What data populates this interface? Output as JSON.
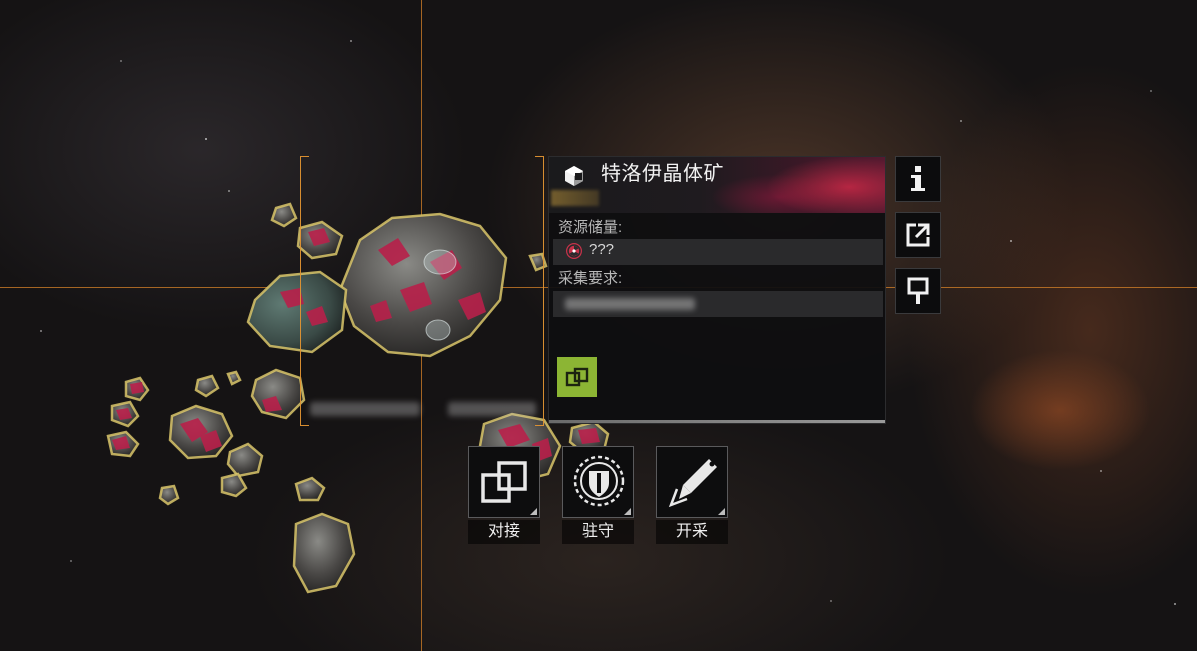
{
  "target": {
    "name": "特洛伊晶体矿",
    "reserves_label": "资源储量:",
    "reserves_value": "???",
    "requirements_label": "采集要求:"
  },
  "side_buttons": [
    {
      "icon": "info-icon"
    },
    {
      "icon": "external-link-icon"
    },
    {
      "icon": "pin-icon"
    }
  ],
  "actions": [
    {
      "label": "对接",
      "icon": "dock-icon"
    },
    {
      "label": "驻守",
      "icon": "garrison-shield-icon"
    },
    {
      "label": "开采",
      "icon": "mining-drill-icon"
    }
  ],
  "colors": {
    "crosshair": "#d6822a",
    "dock_accent": "#8cb534",
    "ore_crystal": "#b8204a",
    "asteroid_outline": "#d9c56a"
  }
}
